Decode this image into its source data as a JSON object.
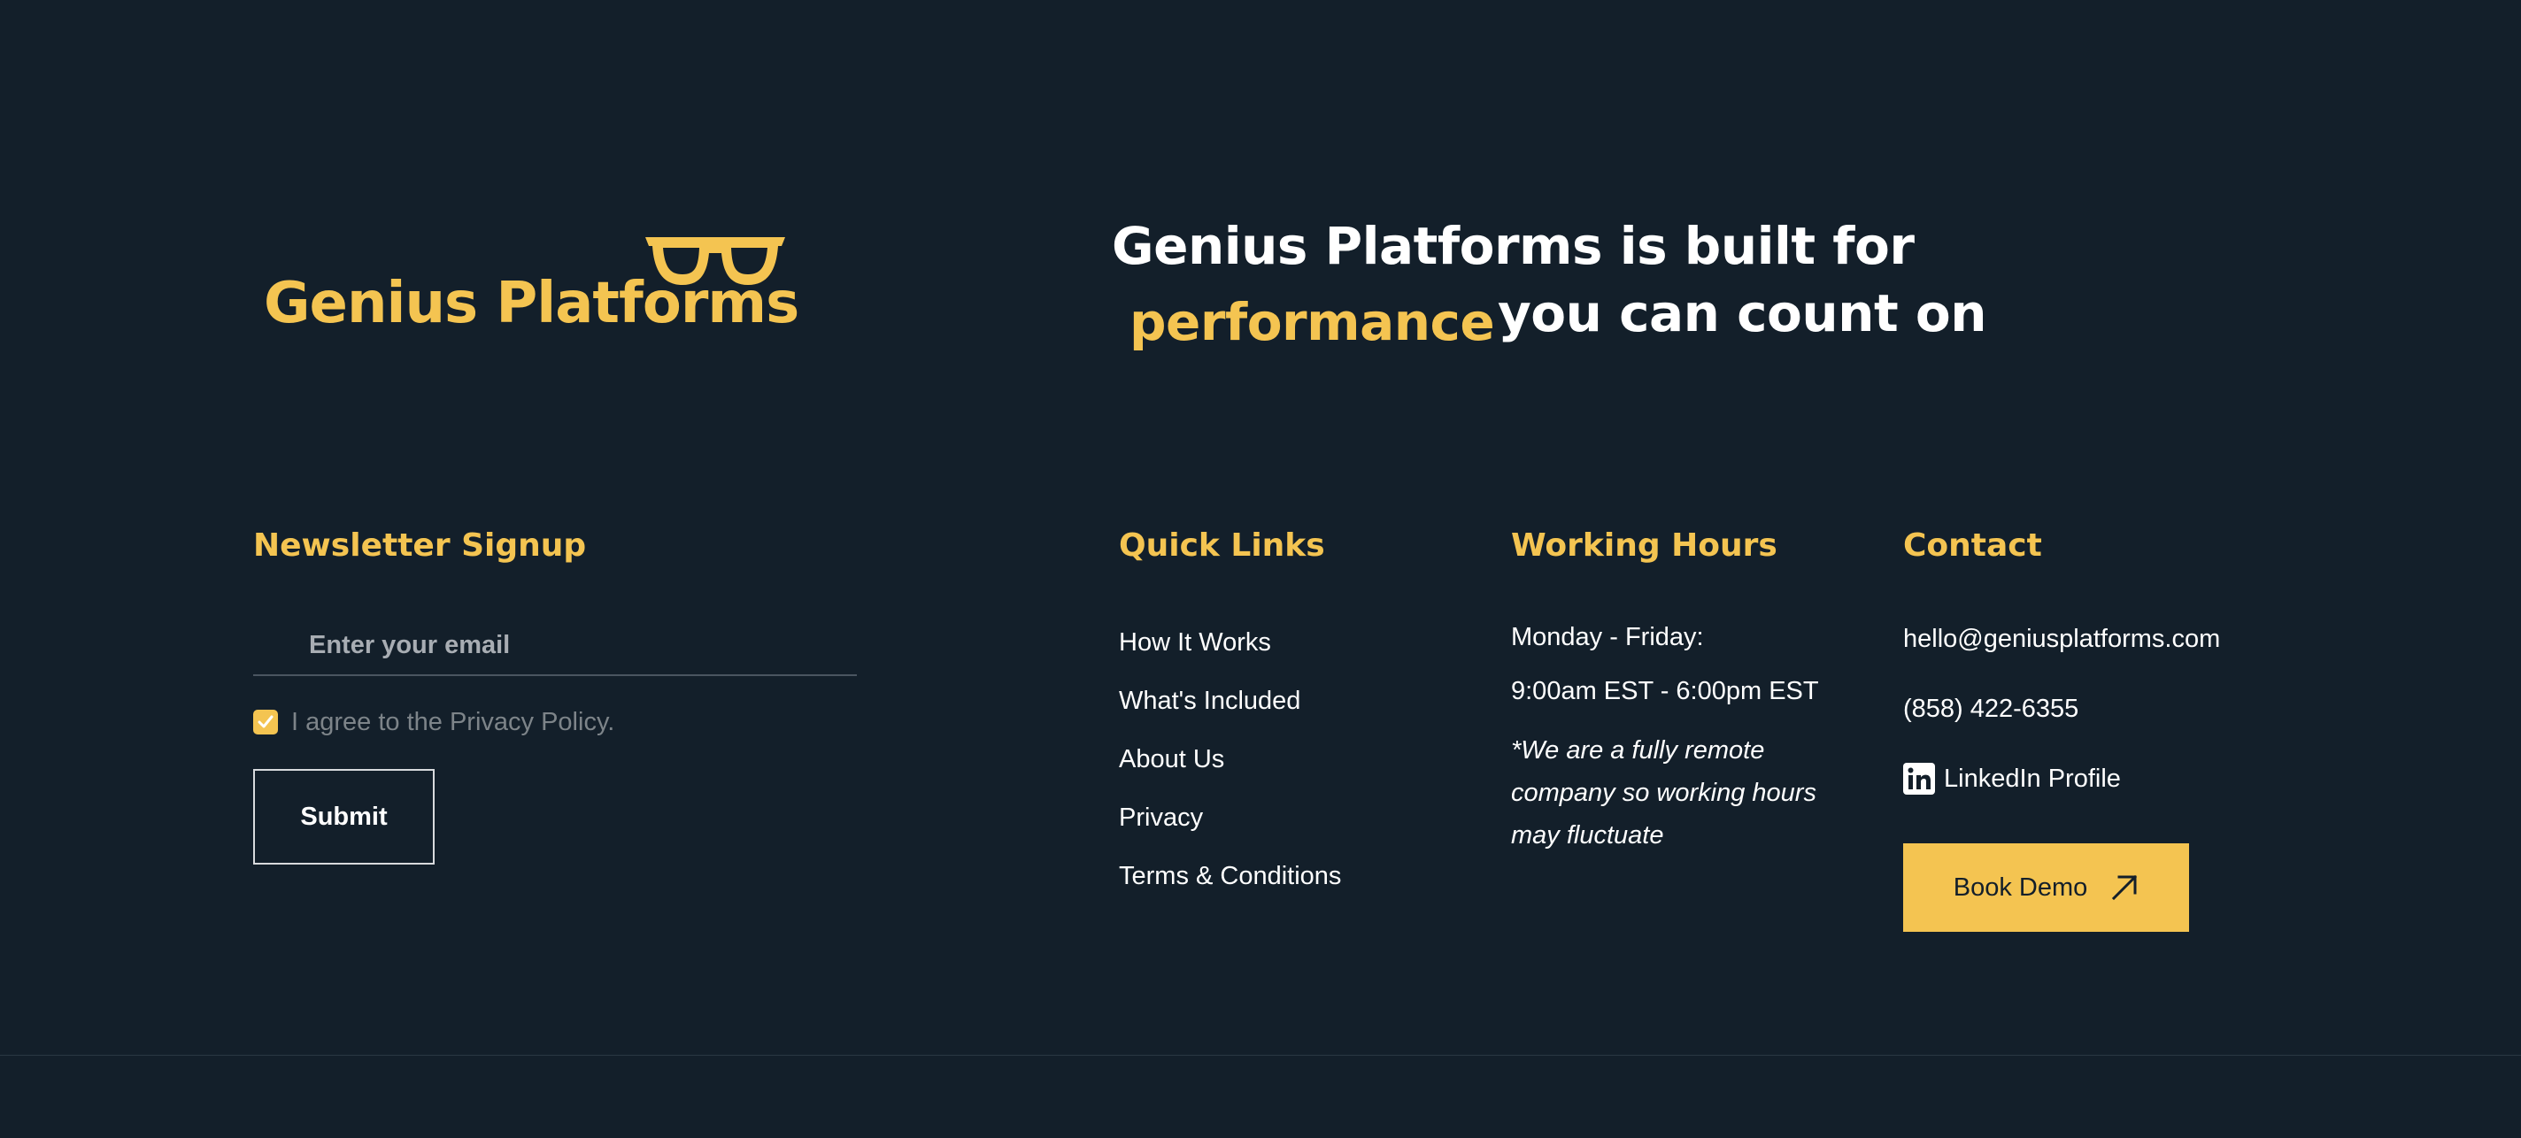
{
  "brand": {
    "logo_text": "Genius Platforms",
    "glasses_icon": "glasses-icon",
    "accent_color": "#f4c451",
    "background_color": "#131f2a"
  },
  "tagline": {
    "line1": "Genius Platforms is built for",
    "accent": "performance",
    "line2": "you can count on"
  },
  "newsletter": {
    "heading": "Newsletter Signup",
    "email_placeholder": "Enter your email",
    "email_value": "",
    "agree_label": "I agree to the Privacy Policy.",
    "agree_checked": true,
    "submit_label": "Submit"
  },
  "quick_links": {
    "heading": "Quick Links",
    "items": [
      {
        "label": "How It Works"
      },
      {
        "label": "What's Included"
      },
      {
        "label": "About Us"
      },
      {
        "label": "Privacy"
      },
      {
        "label": "Terms & Conditions"
      }
    ]
  },
  "working_hours": {
    "heading": "Working Hours",
    "days": "Monday - Friday:",
    "time": "9:00am EST - 6:00pm EST",
    "note": "*We are a fully remote company so working hours may fluctuate"
  },
  "contact": {
    "heading": "Contact",
    "email": "hello@geniusplatforms.com",
    "phone": "(858) 422-6355",
    "linkedin_label": "LinkedIn Profile",
    "linkedin_icon": "linkedin-icon",
    "book_demo_label": "Book Demo",
    "book_demo_icon": "arrow-up-right-icon"
  }
}
